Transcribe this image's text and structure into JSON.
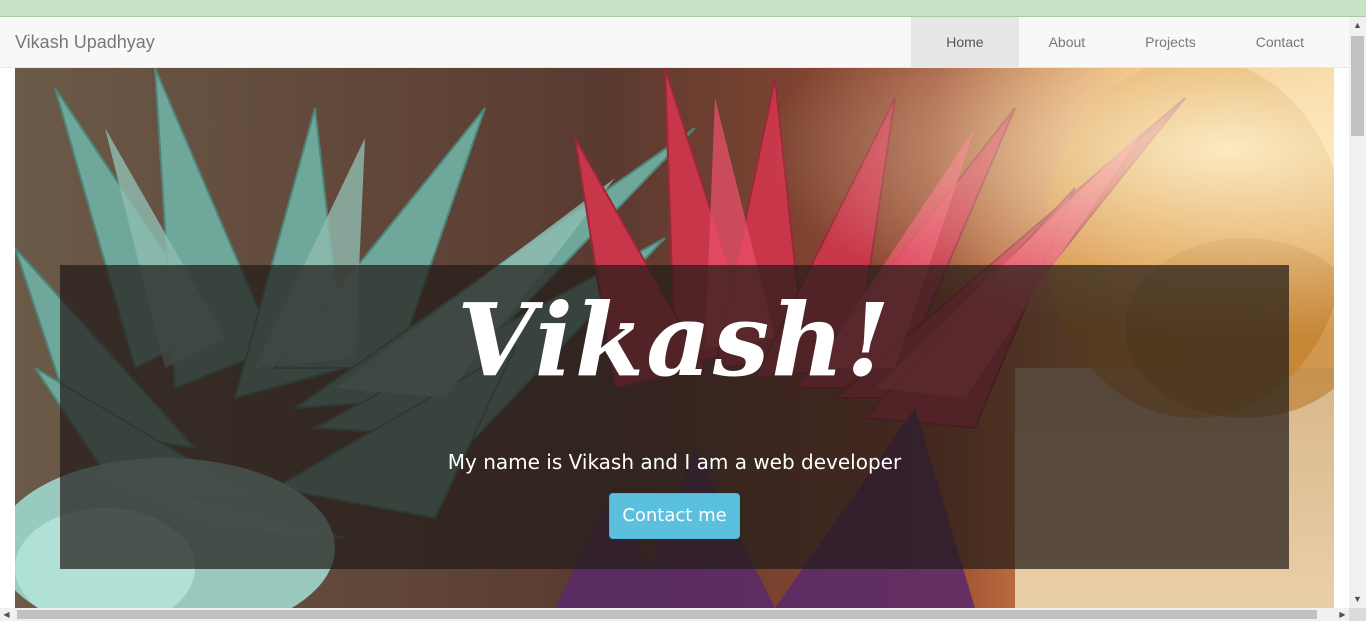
{
  "navbar": {
    "brand": "Vikash Upadhyay",
    "items": [
      {
        "label": "Home",
        "active": true
      },
      {
        "label": "About",
        "active": false
      },
      {
        "label": "Projects",
        "active": false
      },
      {
        "label": "Contact",
        "active": false
      }
    ]
  },
  "hero": {
    "title": "Vikash!",
    "subtitle": "My name is Vikash and I am a web developer",
    "button_label": "Contact me"
  },
  "colors": {
    "navbar_bg": "#f8f8f8",
    "active_nav_bg": "#e7e7e7",
    "button_bg": "#5bc0de",
    "top_strip": "#c8e4c6"
  },
  "icons": {
    "scroll_up": "▲",
    "scroll_down": "▼",
    "scroll_left": "◀",
    "scroll_right": "▶"
  }
}
